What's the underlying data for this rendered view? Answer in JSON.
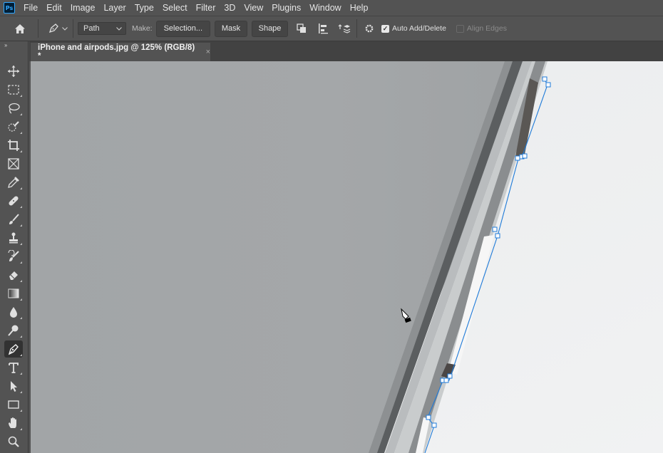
{
  "app": {
    "logo": "Ps"
  },
  "menu": [
    "File",
    "Edit",
    "Image",
    "Layer",
    "Type",
    "Select",
    "Filter",
    "3D",
    "View",
    "Plugins",
    "Window",
    "Help"
  ],
  "options": {
    "mode_value": "Path",
    "make_label": "Make:",
    "selection_btn": "Selection...",
    "mask_btn": "Mask",
    "shape_btn": "Shape",
    "auto_add_delete_label": "Auto Add/Delete",
    "auto_add_delete_checked": true,
    "align_edges_label": "Align Edges",
    "align_edges_checked": false
  },
  "toolbar": {
    "collapse": "››",
    "active_tool": "pen-tool",
    "tools": [
      "move-tool",
      "marquee-tool",
      "lasso-tool",
      "quick-selection-tool",
      "crop-tool",
      "frame-tool",
      "eyedropper-tool",
      "healing-brush-tool",
      "brush-tool",
      "clone-stamp-tool",
      "history-brush-tool",
      "eraser-tool",
      "gradient-tool",
      "blur-tool",
      "dodge-tool",
      "pen-tool",
      "type-tool",
      "path-selection-tool",
      "rectangle-tool",
      "hand-tool",
      "zoom-tool"
    ]
  },
  "document": {
    "tab_title": "iPhone and airpods.jpg @ 125% (RGB/8) *",
    "close_glyph": "×"
  },
  "colors": {
    "ui_bg": "#535353",
    "tab_bar": "#424242",
    "path_blue": "#1e7ad8",
    "phone_gray": "#a3a6a8",
    "background_white": "#eceeef"
  }
}
